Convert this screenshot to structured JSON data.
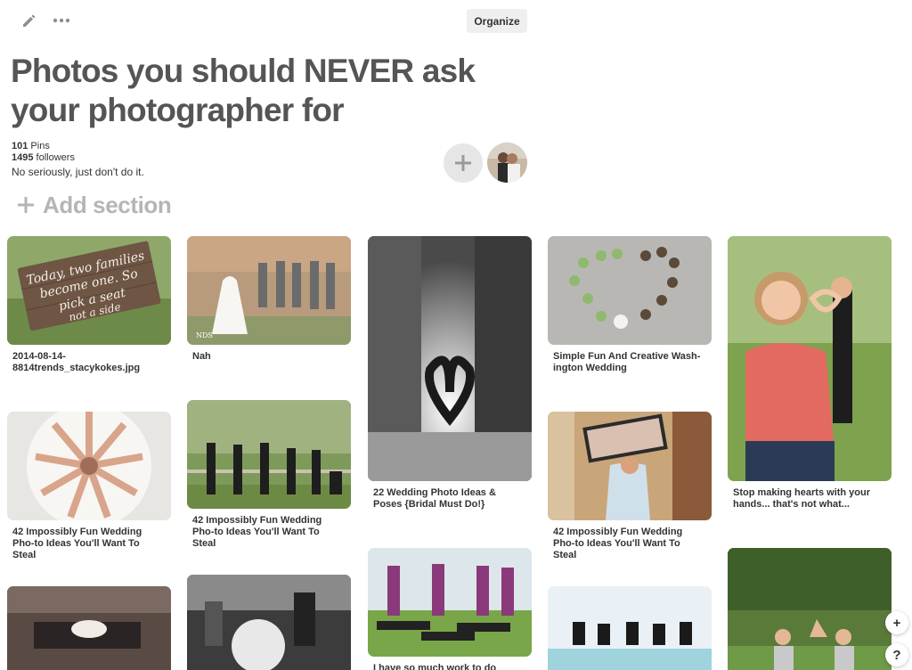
{
  "toolbar": {
    "edit_icon": "pencil-icon",
    "more_icon": "ellipsis-icon",
    "organize_label": "Organize"
  },
  "board": {
    "title": "Photos you should NEVER ask your photographer for",
    "pins_count": "101",
    "pins_label": "Pins",
    "followers_count": "1495",
    "followers_label": "followers",
    "description": "No seriously, just don't do it."
  },
  "collaborators": {
    "add_icon": "plus-icon",
    "avatar_icon": "avatar"
  },
  "add_section_label": "Add section",
  "pins": [
    {
      "caption": "2014-08-14-\n8814trends_stacykokes.jpg",
      "sign_text": "Today two families become one. So pick a seat not a side"
    },
    {
      "caption": "Nah"
    },
    {
      "caption": "22 Wedding Photo Ideas & Poses {Bridal Must Do!}"
    },
    {
      "caption": "Simple Fun And Creative Wash-ington Wedding"
    },
    {
      "caption": "Stop making hearts with your hands... that's not what..."
    },
    {
      "caption": "42 Impossibly Fun Wedding Pho-to Ideas You'll Want To Steal"
    },
    {
      "caption": "42 Impossibly Fun Wedding Pho-to Ideas You'll Want To Steal"
    },
    {
      "caption": "42 Impossibly Fun Wedding Pho-to Ideas You'll Want To Steal"
    },
    {
      "caption": "I have so much work to do"
    },
    {
      "caption": ""
    },
    {
      "caption": ""
    },
    {
      "caption": ""
    }
  ],
  "fabs": {
    "add_label": "+",
    "help_label": "?"
  },
  "colors": {
    "title": "#555555",
    "muted": "#b5b5b5",
    "button_bg": "#efefef"
  }
}
